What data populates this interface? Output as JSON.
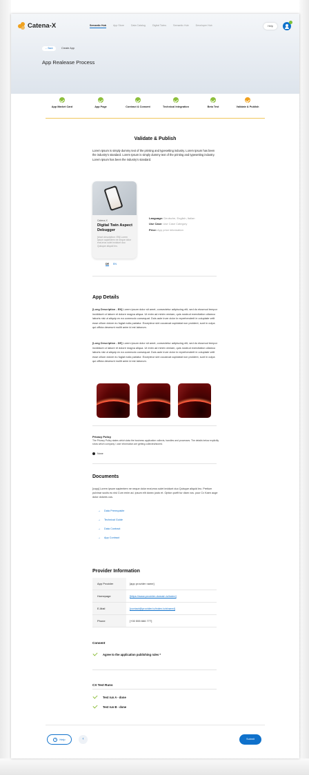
{
  "header": {
    "logo": "Catena-X",
    "nav": [
      "Semantic Hub",
      "App Store",
      "Data Catalog",
      "Digital Twins",
      "Semantic Hub",
      "Developer Hub"
    ],
    "help": "Help"
  },
  "hero": {
    "back": "Back",
    "breadcrumb": "Create App",
    "title": "App Realease Process"
  },
  "stepper": [
    {
      "label": "App Market Card",
      "state": "done"
    },
    {
      "label": "App Page",
      "state": "done"
    },
    {
      "label": "Contract & Consent",
      "state": "done"
    },
    {
      "label": "Technical Integration",
      "state": "done"
    },
    {
      "label": "Beta Test",
      "state": "done"
    },
    {
      "label": "Validate & Publish",
      "state": "active"
    }
  ],
  "validate": {
    "title": "Validate & Publish",
    "intro": "Lorem Ipsum is simply dummy text of the printing and typesetting industry. Lorem Ipsum has been the industry's standard. Lorem Ipsum is simply dummy text of the printing and typesetting industry. Lorem Ipsum has been the industry's standard."
  },
  "card": {
    "provider": "Catena-X",
    "name": "Digital Twin Aspect Debugger",
    "description": "[short description: EN] Lorem ipsum sapientem ne neque dolor erat,eros solet invidunt duo Quisque aliquid leo."
  },
  "languages": [
    "DE",
    "EN"
  ],
  "meta": {
    "language_label": "Language:",
    "language_value": "Deutsche, English, Italian",
    "usecase_label": "Use Case:",
    "usecase_value": "Use Case Category",
    "price_label": "Price:",
    "price_value": "App price information"
  },
  "app_details": {
    "title": "App Details",
    "en_label": "[Long Description - EN]",
    "en_text": " Lorem ipsum dolor sit amet, consectetur adipiscing elit, sed do eiusmod tempor incididunt ut labore et dolore magna aliqua. Ut enim ad minim veniam, quis nostrud exercitation ullamco laboris nisi ut aliquip ex ea commodo consequat. Duis aute irure dolor in reprehenderit in voluptate velit esse cillum dolore eu fugiat nulla pariatur. Excepteur sint occaecat cupidatat non proident, sunt in culpa qui officia deserunt mollit anim id est laborum.",
    "de_label": "[Long Description - DE]",
    "de_text": " Lorem ipsum dolor sit amet, consectetur adipiscing elit, sed do eiusmod tempor incididunt ut labore et dolore magna aliqua. Ut enim ad minim veniam, quis nostrud exercitation ullamco laboris nisi ut aliquip ex ea commodo consequat. Duis aute irure dolor in reprehenderit in voluptate velit esse cillum dolore eu fugiat nulla pariatur. Excepteur sint occaecat cupidatat non proident, sunt in culpa qui officia deserunt mollit anim id est laborum."
  },
  "privacy": {
    "title": "Privacy Policy",
    "text": "The Privacy Policy states which data the business application collects, handles and processes. The details below explicitly show which company / user information are getting collected/stored.",
    "none": "None"
  },
  "documents": {
    "title": "Documents",
    "text": "[copy] Lorem ipsum sapientem ne neque dolor erat,eros solet invidunt duo Quisque aliquid leo. Pretium pulvinar sociis eu nisl Cum enim ad, ipsum elit donec justo et. Option purfit tur diam vos. your Cx Kaen auge dolor dolores cus.",
    "items": [
      "Data Prerequisite",
      "Technical Guide",
      "Data Contract",
      "App Contract"
    ]
  },
  "provider": {
    "title": "Provider Information",
    "rows": [
      {
        "key": "App Provider",
        "value": "[app provider name]"
      },
      {
        "key": "Homepage",
        "value": "[https://www.provider-domain.io/index]"
      },
      {
        "key": "E-Mail",
        "value": "[contact@provider.io/index.io/shared]"
      },
      {
        "key": "Phone",
        "value": "[+00 555 666 777]"
      }
    ]
  },
  "consent": {
    "title": "Consent",
    "item": "Agree to the application publishing rules *"
  },
  "cx_test": {
    "title": "CX Test Runs",
    "items": [
      "Test run A - done",
      "Test run B - done"
    ]
  },
  "footer": {
    "help": "Help",
    "submit": "Submit"
  }
}
